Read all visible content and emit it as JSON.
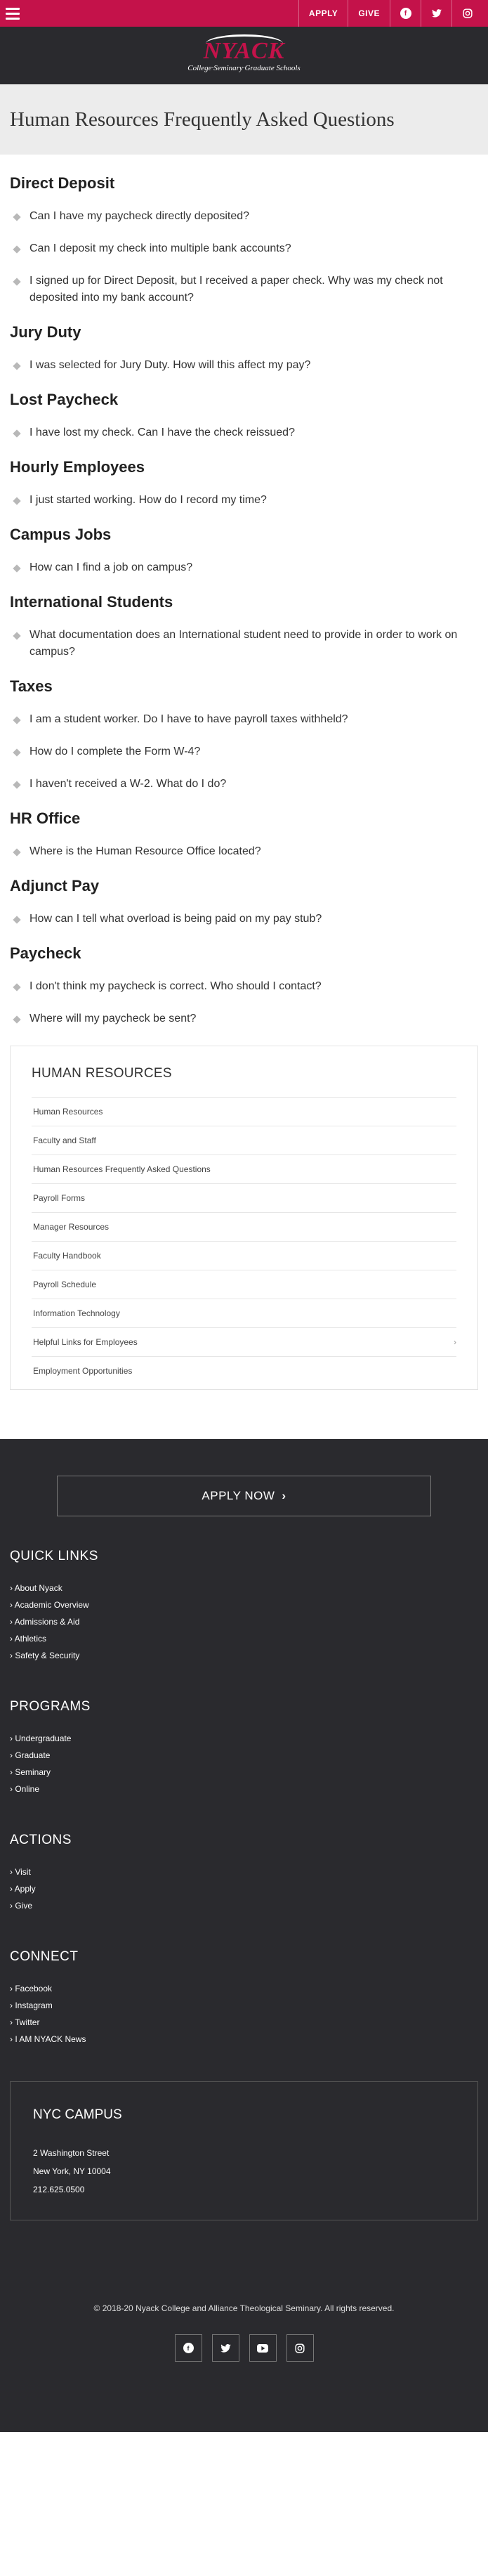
{
  "topbar": {
    "apply_label": "APPLY",
    "give_label": "GIVE",
    "social_icons": [
      "facebook-icon",
      "twitter-icon",
      "instagram-icon"
    ]
  },
  "brand": {
    "logo_word": "NYACK",
    "logo_sub": "College·Seminary·Graduate Schools"
  },
  "page_title": "Human Resources Frequently Asked Questions",
  "faq": [
    {
      "category": "Direct Deposit",
      "questions": [
        "Can I have my paycheck directly deposited?",
        "Can I deposit my check into multiple bank accounts?",
        "I signed up for Direct Deposit, but I received a paper check. Why was my check not deposited into my bank account?"
      ]
    },
    {
      "category": "Jury Duty",
      "questions": [
        "I was selected for Jury Duty. How will this affect my pay?"
      ]
    },
    {
      "category": "Lost Paycheck",
      "questions": [
        "I have lost my check. Can I have the check reissued?"
      ]
    },
    {
      "category": "Hourly Employees",
      "questions": [
        "I just started working. How do I record my time?"
      ]
    },
    {
      "category": "Campus Jobs",
      "questions": [
        "How can I find a job on campus?"
      ]
    },
    {
      "category": "International Students",
      "questions": [
        "What documentation does an International student need to provide in order to work on campus?"
      ]
    },
    {
      "category": "Taxes",
      "questions": [
        "I am a student worker. Do I have to have payroll taxes withheld?",
        "How do I complete the Form W-4?",
        "I haven't received a W-2. What do I do?"
      ]
    },
    {
      "category": "HR Office",
      "questions": [
        "Where is the Human Resource Office located?"
      ]
    },
    {
      "category": "Adjunct Pay",
      "questions": [
        "How can I tell what overload is being paid on my pay stub?"
      ]
    },
    {
      "category": "Paycheck",
      "questions": [
        "I don't think my paycheck is correct. Who should I contact?",
        "Where will my paycheck be sent?"
      ]
    }
  ],
  "sidebar": {
    "title": "HUMAN RESOURCES",
    "items": [
      "Human Resources",
      "Faculty and Staff",
      "Human Resources Frequently Asked Questions",
      "Payroll Forms",
      "Manager Resources",
      "Faculty Handbook",
      "Payroll Schedule",
      "Information Technology",
      "Helpful Links for Employees",
      "Employment Opportunities"
    ],
    "expandable_item_index": 8,
    "expand_glyph": "›"
  },
  "footer": {
    "apply_now_label": "APPLY NOW",
    "apply_arrow": "›",
    "quick_links": {
      "heading": "QUICK LINKS",
      "items": [
        "› About Nyack",
        "› Academic Overview",
        "› Admissions & Aid",
        "› Athletics",
        "› Safety & Security"
      ]
    },
    "programs": {
      "heading": "PROGRAMS",
      "items": [
        "› Undergraduate",
        "› Graduate",
        "› Seminary",
        "› Online"
      ]
    },
    "actions": {
      "heading": "ACTIONS",
      "items": [
        "› Visit",
        "› Apply",
        "› Give"
      ]
    },
    "connect": {
      "heading": "CONNECT",
      "items": [
        "› Facebook",
        "› Instagram",
        "› Twitter",
        "› I AM NYACK News"
      ]
    },
    "campus": {
      "name": "NYC CAMPUS",
      "address1": "2 Washington Street",
      "address2": "New York, NY 10004",
      "phone": "212.625.0500"
    },
    "copyright": "© 2018-20 Nyack College and Alliance Theological Seminary. All rights reserved.",
    "social_icons": [
      "facebook-icon",
      "twitter-icon",
      "youtube-icon",
      "instagram-icon"
    ]
  },
  "colors": {
    "brand_red": "#c4124a",
    "dark_band": "#2a2a2e",
    "hero_bg": "#ececec"
  }
}
